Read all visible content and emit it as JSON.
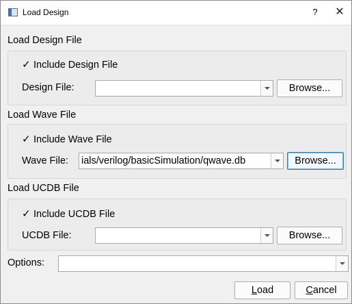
{
  "window": {
    "title": "Load Design",
    "help_label": "?",
    "close_label": "✕"
  },
  "design": {
    "section_title": "Load Design File",
    "include_label": "Include Design File",
    "include_checked": true,
    "field_label": "Design File:",
    "value": "",
    "browse_label": "Browse..."
  },
  "wave": {
    "section_title": "Load Wave File",
    "include_label": "Include Wave File",
    "include_checked": true,
    "field_label": "Wave File:",
    "value": "ials/verilog/basicSimulation/qwave.db",
    "browse_label": "Browse..."
  },
  "ucdb": {
    "section_title": "Load UCDB File",
    "include_label": "Include UCDB File",
    "include_checked": true,
    "field_label": "UCDB File:",
    "value": "",
    "browse_label": "Browse..."
  },
  "options": {
    "label": "Options:",
    "value": ""
  },
  "footer": {
    "load_label_mnemonic": "L",
    "load_label_rest": "oad",
    "cancel_label_mnemonic": "C",
    "cancel_label_rest": "ancel"
  },
  "icons": {
    "check": "✓",
    "app": "window-icon",
    "dropdown": "chevron-down-icon"
  }
}
